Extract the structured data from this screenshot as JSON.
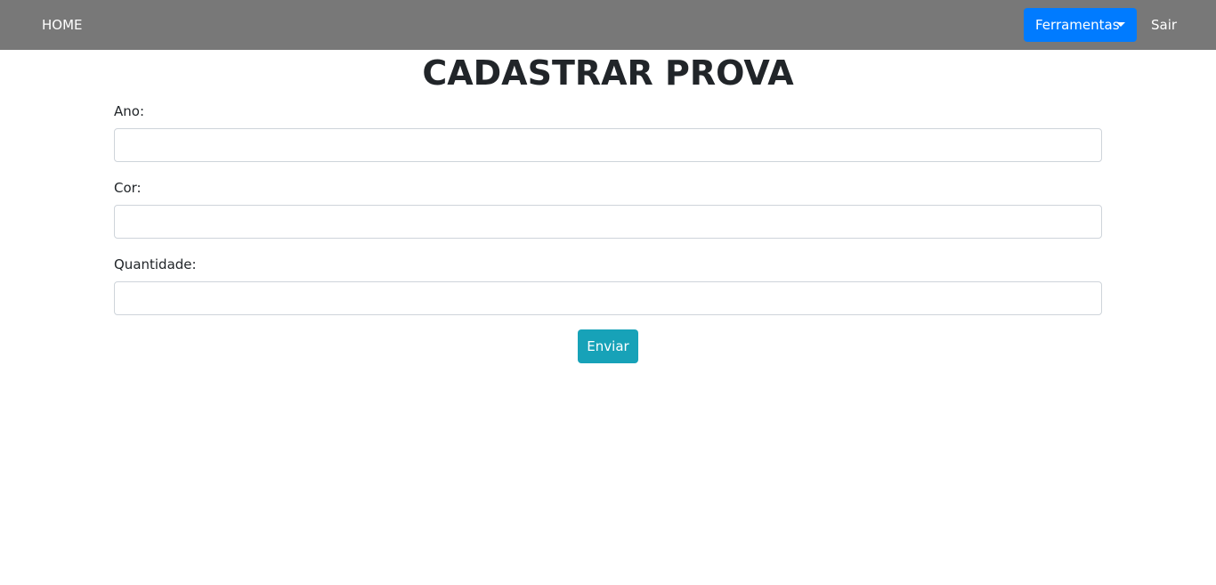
{
  "navbar": {
    "home_label": "HOME",
    "tools_label": "Ferramentas",
    "exit_label": "Sair"
  },
  "page": {
    "title": "CADASTRAR PROVA"
  },
  "form": {
    "fields": [
      {
        "label": "Ano:",
        "value": "",
        "placeholder": ""
      },
      {
        "label": "Cor:",
        "value": "",
        "placeholder": ""
      },
      {
        "label": "Quantidade:",
        "value": "",
        "placeholder": ""
      }
    ],
    "submit_label": "Enviar"
  },
  "colors": {
    "navbar_bg": "#787878",
    "primary_button": "#007bff",
    "submit_button": "#17a2b8"
  }
}
